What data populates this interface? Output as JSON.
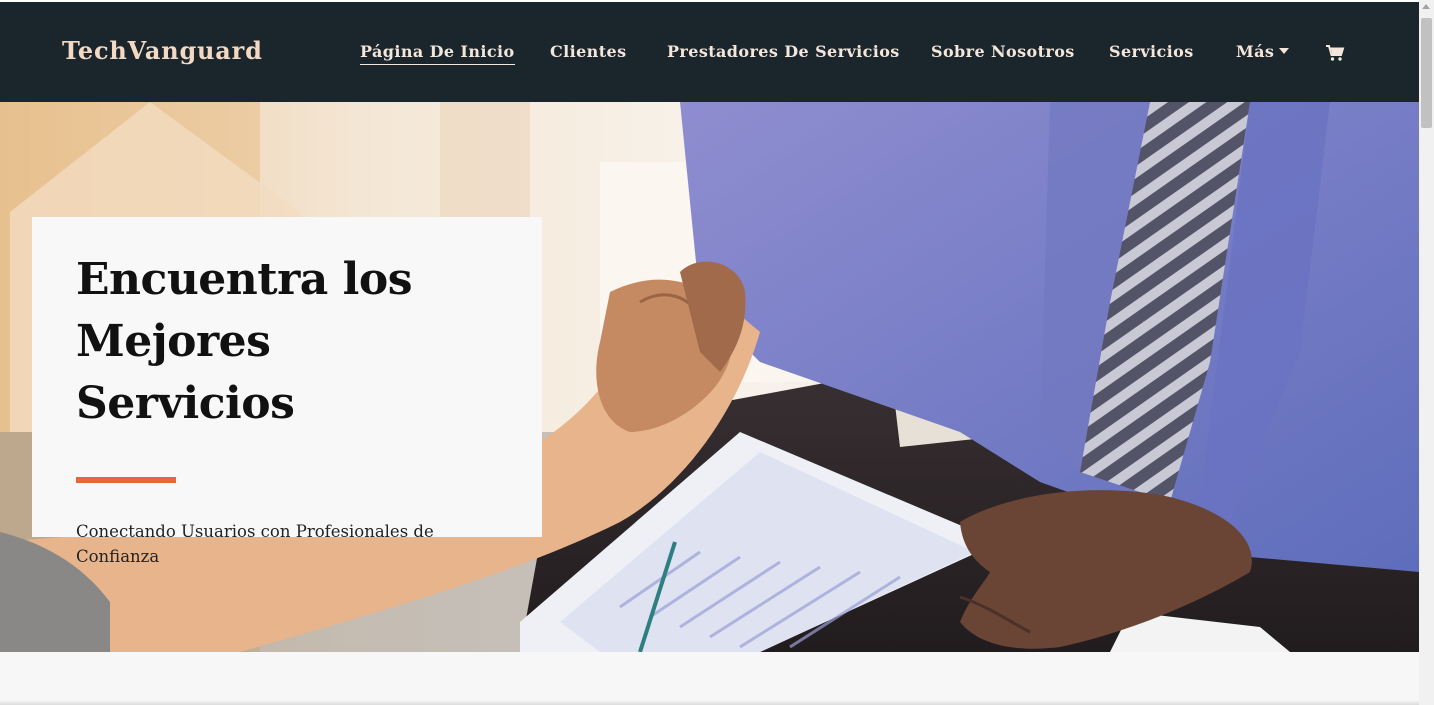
{
  "brand": "TechVanguard",
  "nav": {
    "items": [
      {
        "label": "Página De Inicio",
        "active": true
      },
      {
        "label": "Clientes"
      },
      {
        "label": "Prestadores De Servicios"
      },
      {
        "label": "Sobre Nosotros"
      },
      {
        "label": "Servicios"
      },
      {
        "label": "Más"
      }
    ],
    "cart_icon": "shopping-cart-icon"
  },
  "hero": {
    "title_line1": "Encuentra los",
    "title_line2": "Mejores Servicios",
    "subtitle": "Conectando Usuarios con Profesionales de Confianza",
    "image": "business-handshake-photo"
  },
  "colors": {
    "navbar_bg": "#1b252c",
    "brand_text": "#f3d9c4",
    "accent_rule": "#e8663c",
    "card_bg": "#f8f8f8"
  }
}
